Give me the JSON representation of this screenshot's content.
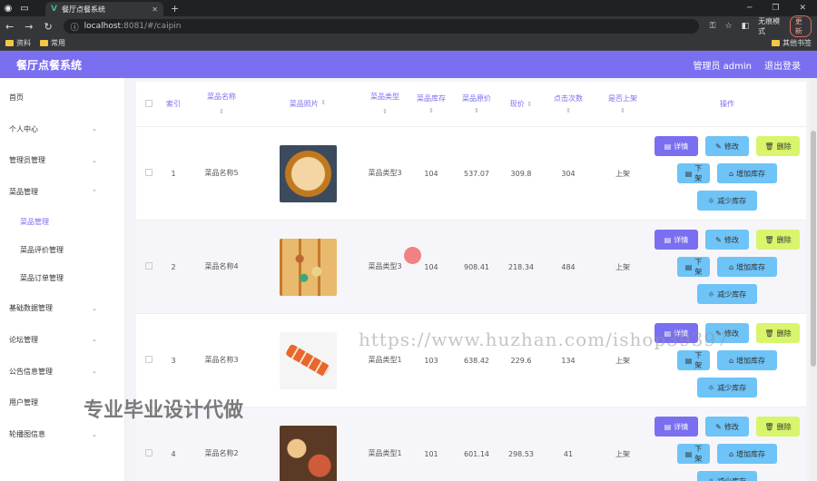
{
  "browser": {
    "tab_title": "餐厅点餐系统",
    "url_host": "localhost",
    "url_rest": ":8081/#/caipin",
    "incognito_label": "无痕模式",
    "update_label": "更新",
    "bookmarks": [
      "资料",
      "常用"
    ],
    "bookmarks_right": "其他书签"
  },
  "app": {
    "title": "餐厅点餐系统",
    "user_label": "管理员 admin",
    "logout_label": "退出登录"
  },
  "sidebar": {
    "items": [
      {
        "label": "首页"
      },
      {
        "label": "个人中心"
      },
      {
        "label": "管理员管理"
      },
      {
        "label": "菜品管理"
      },
      {
        "label": "菜品管理"
      },
      {
        "label": "菜品评价管理"
      },
      {
        "label": "菜品订单管理"
      },
      {
        "label": "基础数据管理"
      },
      {
        "label": "论坛管理"
      },
      {
        "label": "公告信息管理"
      },
      {
        "label": "用户管理"
      },
      {
        "label": "轮播图信息"
      }
    ]
  },
  "table": {
    "headers": {
      "index": "索引",
      "name": "菜品名称",
      "image": "菜品照片",
      "type": "菜品类型",
      "stock": "菜品库存",
      "price": "菜品原价",
      "now_price": "现价",
      "clicks": "点击次数",
      "on_shelf": "是否上架",
      "ops": "操作"
    },
    "rows": [
      {
        "index": "1",
        "name": "菜品名称5",
        "type": "菜品类型3",
        "stock": "104",
        "price": "537.07",
        "now_price": "309.8",
        "clicks": "304",
        "on_shelf": "上架"
      },
      {
        "index": "2",
        "name": "菜品名称4",
        "type": "菜品类型3",
        "stock": "104",
        "price": "908.41",
        "now_price": "218.34",
        "clicks": "484",
        "on_shelf": "上架"
      },
      {
        "index": "3",
        "name": "菜品名称3",
        "type": "菜品类型1",
        "stock": "103",
        "price": "638.42",
        "now_price": "229.6",
        "clicks": "134",
        "on_shelf": "上架"
      },
      {
        "index": "4",
        "name": "菜品名称2",
        "type": "菜品类型1",
        "stock": "101",
        "price": "601.14",
        "now_price": "298.53",
        "clicks": "41",
        "on_shelf": "上架"
      }
    ],
    "buttons": {
      "detail": "详情",
      "edit": "修改",
      "delete": "删除",
      "off_shelf": "下架",
      "add_stock": "增加库存",
      "reduce_stock": "减少库存"
    }
  },
  "watermarks": {
    "site": "https://www.huzhan.com/ishop39397",
    "service": "专业毕业设计代做"
  }
}
